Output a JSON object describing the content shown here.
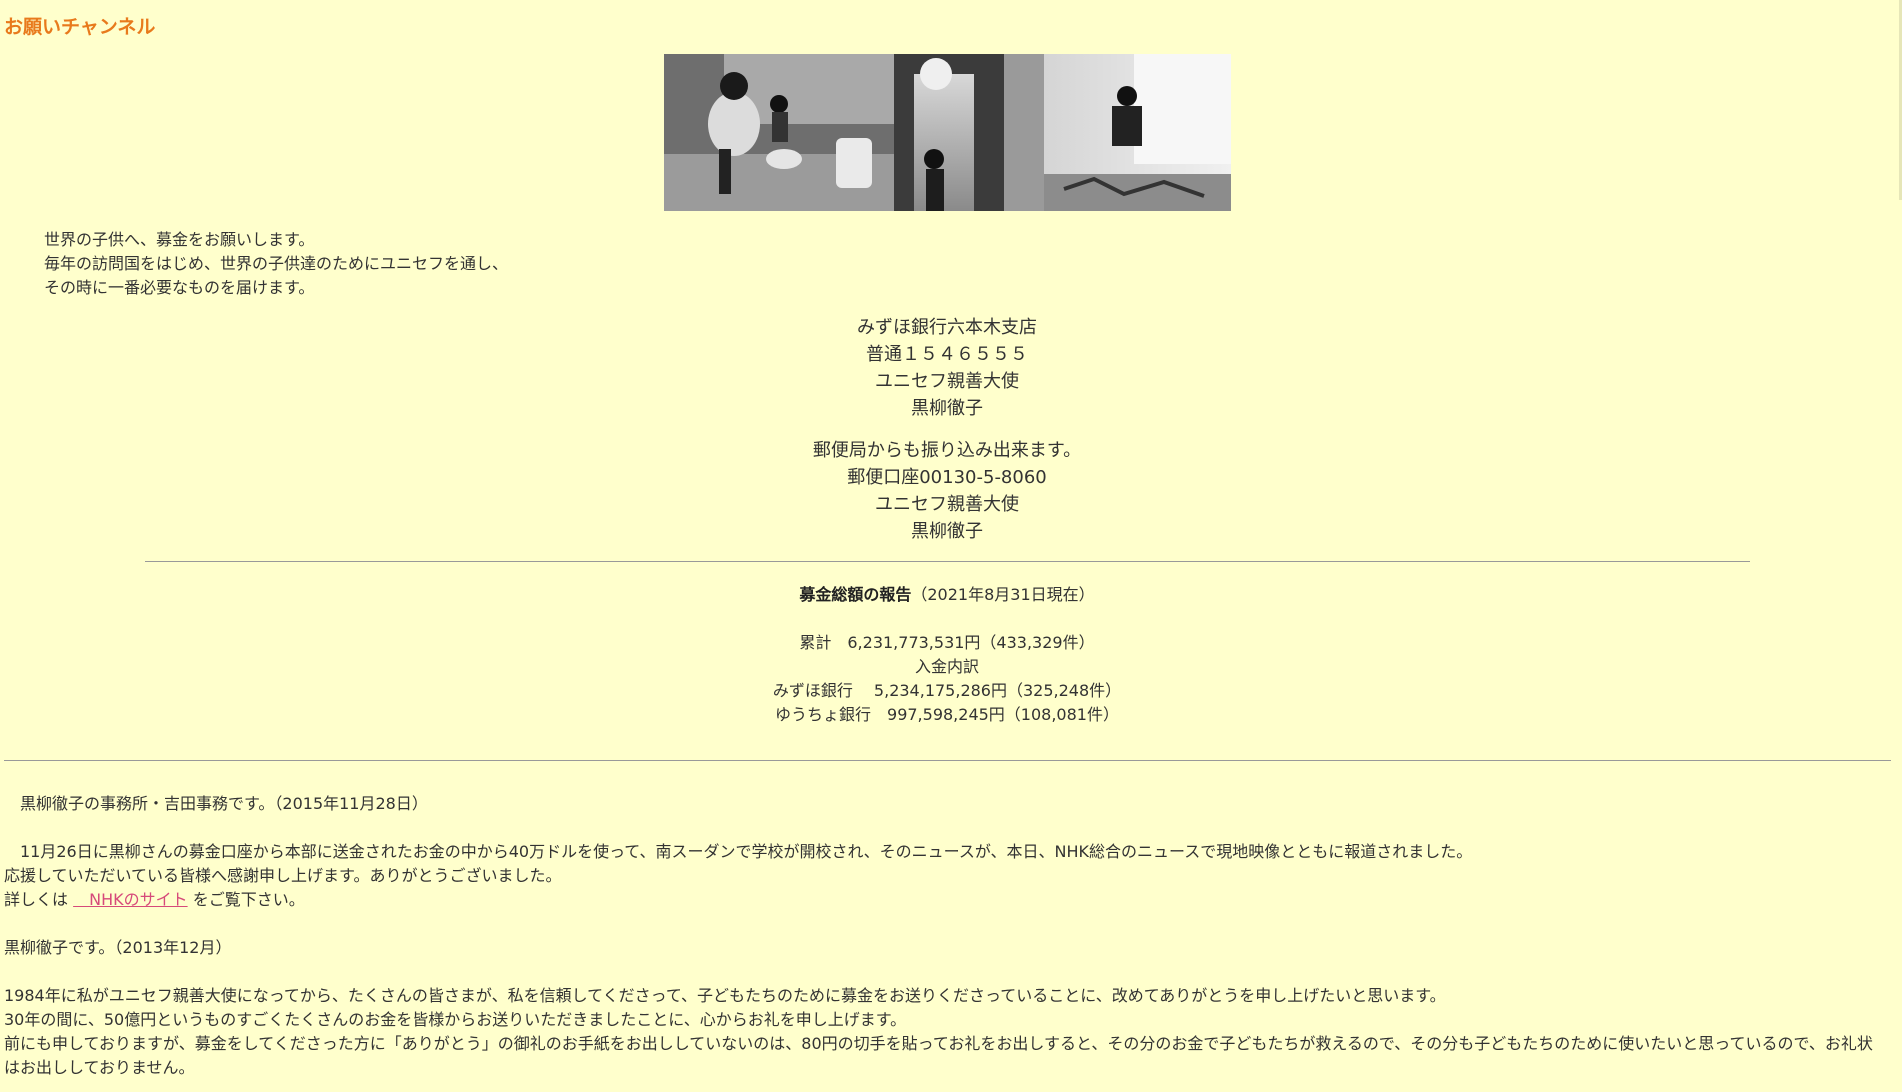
{
  "page": {
    "title": "お願いチャンネル"
  },
  "intro": {
    "line1": "世界の子供へ、募金をお願いします。",
    "line2": "毎年の訪問国をはじめ、世界の子供達のためにユニセフを通し、",
    "line3": "その時に一番必要なものを届けます。"
  },
  "bank": {
    "name": "みずほ銀行六本木支店",
    "account": "普通１５４６５５５",
    "holder_title": "ユニセフ親善大使",
    "holder_name": "黒柳徹子"
  },
  "post": {
    "note": "郵便局からも振り込み出来ます。",
    "account": "郵便口座00130-5-8060",
    "holder_title": "ユニセフ親善大使",
    "holder_name": "黒柳徹子"
  },
  "report": {
    "title": "募金総額の報告",
    "date": "（2021年8月31日現在）",
    "total": "累計　6,231,773,531円（433,329件）",
    "breakdown_label": "入金内訳",
    "mizuho": "みずほ銀行　 5,234,175,286円（325,248件）",
    "yucho": "ゆうちょ銀行　997,598,245円（108,081件）"
  },
  "news": {
    "office_header": "　黒柳徹子の事務所・吉田事務です。（2015年11月28日）",
    "office_line1": "　11月26日に黒柳さんの募金口座から本部に送金されたお金の中から40万ドルを使って、南スーダンで学校が開校され、そのニュースが、本日、NHK総合のニュースで現地映像とともに報道されました。",
    "office_line2": "応援していただいている皆様へ感謝申し上げます。ありがとうございました。",
    "details_prefix": "詳しくは",
    "nhk_link": "　NHKのサイト",
    "details_suffix": "をご覧下さい。",
    "kuroyanagi_header": "黒柳徹子です。（2013年12月）",
    "kuroyanagi_line1": "1984年に私がユニセフ親善大使になってから、たくさんの皆さまが、私を信頼してくださって、子どもたちのために募金をお送りくださっていることに、改めてありがとうを申し上げたいと思います。",
    "kuroyanagi_line2": "30年の間に、50億円というものすごくたくさんのお金を皆様からお送りいただきましたことに、心からお礼を申し上げます。",
    "kuroyanagi_line3": "前にも申しておりますが、募金をしてくださった方に「ありがとう」の御礼のお手紙をお出ししていないのは、80円の切手を貼ってお礼をお出しすると、その分のお金で子どもたちが救えるので、その分も子どもたちのために使いたいと思っているので、お礼状はお出ししておりません。"
  }
}
